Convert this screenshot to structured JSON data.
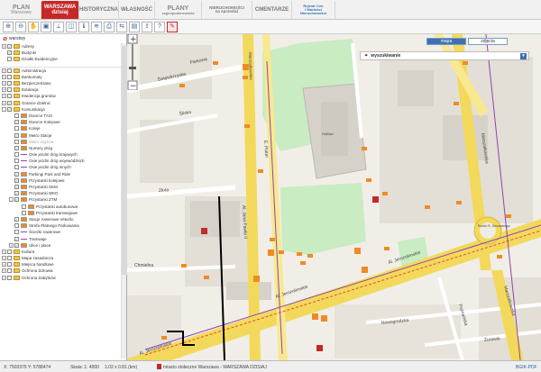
{
  "tabs": [
    {
      "line1": "PLAN",
      "line2": "Warszawy"
    },
    {
      "line1": "WARSZAWA",
      "line2": "dzisiaj"
    },
    {
      "line1": "HISTORYCZNA",
      "line2": ""
    },
    {
      "line1": "WŁASNOŚĆ",
      "line2": ""
    },
    {
      "line1": "PLANY",
      "line2": "zagospodarowania"
    },
    {
      "line1": "NIERUCHOMOŚCI",
      "line2": "na sprzedaż"
    },
    {
      "line1": "CMENTARZE",
      "line2": ""
    },
    {
      "line1": "Rejestr Cen",
      "line2": "i Wartości Nieruchomości"
    }
  ],
  "panel": {
    "title": "warstwy"
  },
  "layers": [
    {
      "label": "Adresy",
      "indent": 1,
      "exp": "+",
      "checked": true,
      "icon": "folder"
    },
    {
      "label": "Budynki",
      "indent": 1,
      "exp": "",
      "checked": true,
      "icon": "folder"
    },
    {
      "label": "Działki Ewidencyjne",
      "indent": 1,
      "exp": "",
      "checked": false,
      "icon": "folder"
    },
    {
      "label": "",
      "indent": 0,
      "exp": "",
      "checked": false,
      "icon": "none"
    },
    {
      "label": "Administracja",
      "indent": 1,
      "exp": "+",
      "checked": false,
      "icon": "folder"
    },
    {
      "label": "Bankomaty",
      "indent": 1,
      "exp": "+",
      "checked": false,
      "icon": "folder"
    },
    {
      "label": "Bezpieczeństwo",
      "indent": 1,
      "exp": "+",
      "checked": false,
      "icon": "folder"
    },
    {
      "label": "Edukacja",
      "indent": 1,
      "exp": "+",
      "checked": false,
      "icon": "folder"
    },
    {
      "label": "Ewidencja gruntów",
      "indent": 1,
      "exp": "+",
      "checked": false,
      "icon": "folder"
    },
    {
      "label": "Granice dzielnic",
      "indent": 1,
      "exp": "+",
      "checked": true,
      "icon": "folder"
    },
    {
      "label": "Komunikacja",
      "indent": 1,
      "exp": "-",
      "checked": true,
      "icon": "folder"
    },
    {
      "label": "Dworce TAXI",
      "indent": 2,
      "exp": "",
      "checked": false,
      "icon": "leg"
    },
    {
      "label": "Dworce Kolejowe",
      "indent": 2,
      "exp": "",
      "checked": true,
      "icon": "leg"
    },
    {
      "label": "Koleje",
      "indent": 2,
      "exp": "",
      "checked": false,
      "icon": "leg"
    },
    {
      "label": "Metro Stacje",
      "indent": 2,
      "exp": "",
      "checked": true,
      "icon": "leg"
    },
    {
      "label": "Metro wyjścia",
      "indent": 2,
      "exp": "",
      "checked": false,
      "icon": "leg",
      "grey": true
    },
    {
      "label": "Numery dróg",
      "indent": 2,
      "exp": "",
      "checked": true,
      "icon": "leg"
    },
    {
      "label": "Osie jezdni dróg krajowych",
      "indent": 2,
      "exp": "",
      "checked": false,
      "icon": "line"
    },
    {
      "label": "Osie jezdni dróg wojewódzkich",
      "indent": 2,
      "exp": "",
      "checked": false,
      "icon": "line"
    },
    {
      "label": "Osie jezdni dróg innych",
      "indent": 2,
      "exp": "",
      "checked": false,
      "icon": "line"
    },
    {
      "label": "Parkingi Park and Ride",
      "indent": 2,
      "exp": "",
      "checked": true,
      "icon": "leg"
    },
    {
      "label": "Przystanki kolejowe",
      "indent": 2,
      "exp": "",
      "checked": true,
      "icon": "leg"
    },
    {
      "label": "Przystanki SKM",
      "indent": 2,
      "exp": "",
      "checked": true,
      "icon": "leg"
    },
    {
      "label": "Przystanki WKD",
      "indent": 2,
      "exp": "",
      "checked": true,
      "icon": "leg"
    },
    {
      "label": "Przystanki ZTM",
      "indent": 2,
      "exp": "-",
      "checked": true,
      "icon": "leg"
    },
    {
      "label": "Przystanki autobusowe",
      "indent": 3,
      "exp": "",
      "checked": false,
      "icon": "leg"
    },
    {
      "label": "Przystanki tramwajowe",
      "indent": 3,
      "exp": "",
      "checked": false,
      "icon": "leg"
    },
    {
      "label": "Stacje rowerowe Veturilo",
      "indent": 2,
      "exp": "",
      "checked": true,
      "icon": "leg"
    },
    {
      "label": "Strefa Płatnego Parkowania",
      "indent": 2,
      "exp": "",
      "checked": false,
      "icon": "leg"
    },
    {
      "label": "Ścieżki rowerowe",
      "indent": 2,
      "exp": "",
      "checked": false,
      "icon": "line"
    },
    {
      "label": "Tramwaje",
      "indent": 2,
      "exp": "",
      "checked": true,
      "icon": "line"
    },
    {
      "label": "Ulice i place",
      "indent": 2,
      "exp": "+",
      "checked": true,
      "icon": "leg"
    },
    {
      "label": "Kultura",
      "indent": 1,
      "exp": "+",
      "checked": false,
      "icon": "folder"
    },
    {
      "label": "Mapa zasadnicza",
      "indent": 1,
      "exp": "+",
      "checked": false,
      "icon": "folder"
    },
    {
      "label": "Miejsca handlowe",
      "indent": 1,
      "exp": "+",
      "checked": false,
      "icon": "folder"
    },
    {
      "label": "Ochrona Zdrowia",
      "indent": 1,
      "exp": "+",
      "checked": false,
      "icon": "folder"
    },
    {
      "label": "Ochrona Zabytków",
      "indent": 1,
      "exp": "+",
      "checked": false,
      "icon": "folder"
    }
  ],
  "search": {
    "label": "wyszukiwanie"
  },
  "maptypes": {
    "map": "mapa",
    "photo": "zdjęcia"
  },
  "streets": {
    "swietokrzyska": "Świętokrzyska",
    "marszalkowska": "Marszałkowska",
    "parkowa": "Parkowa",
    "sliska": "Śliska",
    "zlota": "Złota",
    "chmielna": "Chmielna",
    "emilii": "E. Plater",
    "jana_pawla": "Al. Jana Pawła II",
    "jerozolimskie": "Al. Jerozolimskie",
    "nowogrodzka": "Nowogrodzka",
    "poznanska": "Poznańska",
    "zurawia": "Żurawia",
    "rondo": "Rondo R. Dmowskiego",
    "defilad": "Defilad"
  },
  "status": {
    "coords": "X: 7500379 Y: 5788474",
    "scale": "Skala: 1: 4000",
    "zoom": "1.02 x 0.81 (km)",
    "title": "miasto stołeczne Warszawa - WARSZAWA DZISIAJ",
    "pdf": "BGIK-PDF"
  },
  "colors": {
    "accent": "#c62828",
    "tram": "#8e44ad",
    "road": "#f3d95b",
    "stop": "#f08a24",
    "park": "#c9ecc3"
  }
}
